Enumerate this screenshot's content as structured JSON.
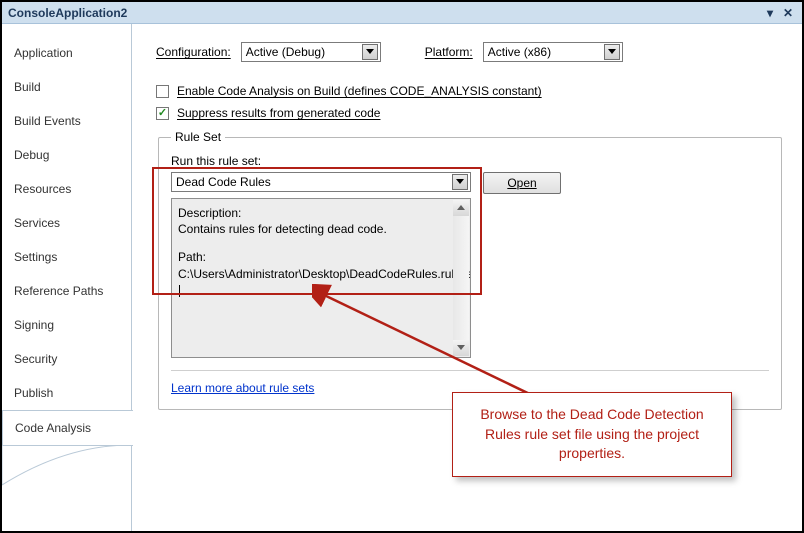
{
  "window": {
    "title": "ConsoleApplication2"
  },
  "sidebar": {
    "items": [
      {
        "label": "Application"
      },
      {
        "label": "Build"
      },
      {
        "label": "Build Events"
      },
      {
        "label": "Debug"
      },
      {
        "label": "Resources"
      },
      {
        "label": "Services"
      },
      {
        "label": "Settings"
      },
      {
        "label": "Reference Paths"
      },
      {
        "label": "Signing"
      },
      {
        "label": "Security"
      },
      {
        "label": "Publish"
      },
      {
        "label": "Code Analysis",
        "active": true
      }
    ]
  },
  "config": {
    "config_label": "Configuration:",
    "config_value": "Active (Debug)",
    "platform_label": "Platform:",
    "platform_value": "Active (x86)"
  },
  "options": {
    "enable_label": "Enable Code Analysis on Build (defines CODE_ANALYSIS constant)",
    "enable_checked": false,
    "suppress_label": "Suppress results from generated code",
    "suppress_checked": true
  },
  "ruleset": {
    "legend": "Rule Set",
    "run_label": "Run this rule set:",
    "select_value": "Dead Code Rules",
    "open_label": "Open",
    "desc_header": "Description:",
    "desc_text": "Contains rules for detecting dead code.",
    "path_header": "Path:",
    "path_value": "C:\\Users\\Administrator\\Desktop\\DeadCodeRules.ruleset"
  },
  "link": {
    "label": "Learn more about rule sets"
  },
  "callout": {
    "text": "Browse to the Dead Code Detection Rules rule set file using the project properties."
  }
}
